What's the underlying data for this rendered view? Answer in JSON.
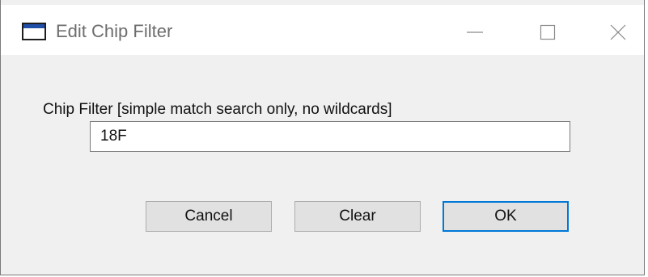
{
  "window": {
    "title": "Edit Chip Filter",
    "icon": "window-app-icon",
    "controls": {
      "minimize_icon": "minimize-icon",
      "maximize_icon": "maximize-icon",
      "close_icon": "close-icon"
    }
  },
  "dialog": {
    "label": "Chip Filter [simple match search only, no wildcards]",
    "filter_value": "18F",
    "buttons": {
      "cancel": "Cancel",
      "clear": "Clear",
      "ok": "OK"
    }
  },
  "colors": {
    "accent": "#0078d7",
    "dialog_background": "#f0f0f0",
    "titlebar_background": "#ffffff"
  }
}
